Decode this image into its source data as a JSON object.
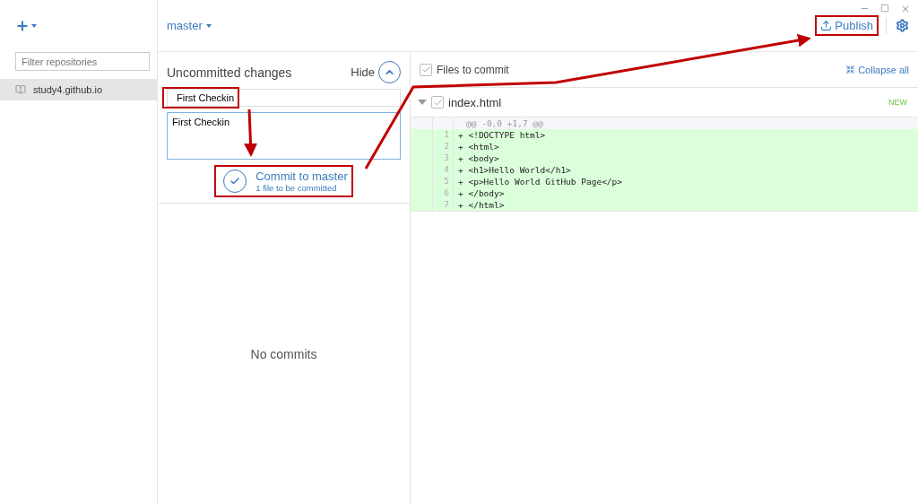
{
  "sidebar": {
    "filter": {
      "placeholder": "Filter repositories"
    },
    "repositories": [
      {
        "name": "study4.github.io",
        "selected": true
      }
    ]
  },
  "toolbar": {
    "branch": "master",
    "publish": {
      "label": "Publish",
      "highlighted": true
    }
  },
  "changes": {
    "title": "Uncommitted changes",
    "hide": "Hide",
    "summary": {
      "value": "First Checkin",
      "highlighted": true
    },
    "description": {
      "value": "First Checkin"
    },
    "commit": {
      "title": "Commit to master",
      "subtitle": "1 file to be committed",
      "highlighted": true
    }
  },
  "history": {
    "empty": "No commits"
  },
  "files": {
    "all_checked": true,
    "label": "Files to commit",
    "collapse": "Collapse all",
    "items": [
      {
        "name": "index.html",
        "checked": true,
        "expanded": true,
        "status": "NEW",
        "hunk": "@@ -0,0 +1,7 @@",
        "lines": [
          {
            "number": "1",
            "sign": "+",
            "code": "<!DOCTYPE html>"
          },
          {
            "number": "2",
            "sign": "+",
            "code": "<html>"
          },
          {
            "number": "3",
            "sign": "+",
            "code": "<body>"
          },
          {
            "number": "4",
            "sign": "+",
            "code": "<h1>Hello World</h1>"
          },
          {
            "number": "5",
            "sign": "+",
            "code": "<p>Hello World GitHub Page</p>"
          },
          {
            "number": "6",
            "sign": "+",
            "code": "</body>"
          },
          {
            "number": "7",
            "sign": "+",
            "code": "</html>"
          }
        ]
      }
    ]
  },
  "annotations": {
    "arrows_shown": true
  }
}
